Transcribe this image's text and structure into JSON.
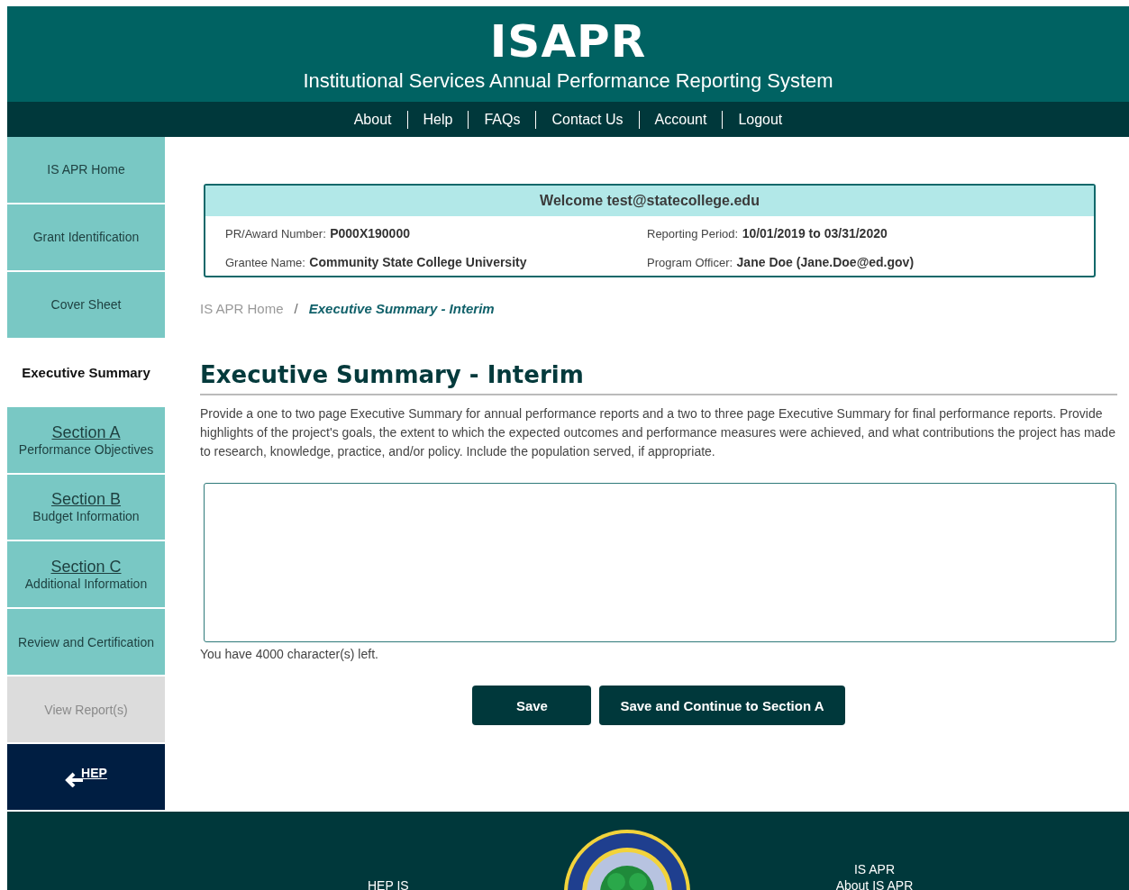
{
  "header": {
    "title": "ISAPR",
    "subtitle": "Institutional Services Annual Performance Reporting System"
  },
  "nav": [
    "About",
    "Help",
    "FAQs",
    "Contact Us",
    "Account",
    "Logout"
  ],
  "sidebar": {
    "items": [
      {
        "kind": "link",
        "label": "IS APR Home",
        "selected": false,
        "disabled": false
      },
      {
        "kind": "link",
        "label": "Grant Identification",
        "selected": false,
        "disabled": false
      },
      {
        "kind": "link",
        "label": "Cover Sheet",
        "selected": false,
        "disabled": false
      },
      {
        "kind": "link",
        "label": "Executive Summary",
        "selected": true,
        "disabled": false
      },
      {
        "kind": "section",
        "label": "Section A",
        "sublabel": "Performance Objectives",
        "selected": false,
        "disabled": false
      },
      {
        "kind": "section",
        "label": "Section B",
        "sublabel": "Budget Information",
        "selected": false,
        "disabled": false
      },
      {
        "kind": "section",
        "label": "Section C",
        "sublabel": "Additional Information",
        "selected": false,
        "disabled": false
      },
      {
        "kind": "link",
        "label": "Review and Certification",
        "selected": false,
        "disabled": false
      },
      {
        "kind": "link",
        "label": "View Report(s)",
        "selected": false,
        "disabled": true
      },
      {
        "kind": "back",
        "label": "HEP",
        "selected": false,
        "disabled": false
      }
    ]
  },
  "info_panel": {
    "welcome": "Welcome test@statecollege.edu",
    "fields": [
      {
        "label": "PR/Award Number:",
        "value": "P000X190000"
      },
      {
        "label": "Reporting Period:",
        "value": "10/01/2019 to 03/31/2020"
      },
      {
        "label": "Grantee Name:",
        "value": "Community State College University"
      },
      {
        "label": "Program Officer:",
        "value": "Jane Doe (Jane.Doe@ed.gov)"
      }
    ]
  },
  "breadcrumb": {
    "items": [
      "IS APR Home",
      "Executive Summary - Interim"
    ],
    "separator": "/"
  },
  "page_title": "Executive Summary - Interim",
  "instructions": "Provide a one to two page Executive Summary for annual performance reports and a two to three page Executive Summary for final performance reports. Provide highlights of the project's goals, the extent to which the expected outcomes and performance measures were achieved, and what contributions the project has made to research, knowledge, practice, and/or policy. Include the population served, if appropriate.",
  "char_count": "You have 4000 character(s) left.",
  "buttons": [
    "Save",
    "Save and Continue to Section A"
  ],
  "footer": {
    "left": "HEP IS",
    "right": [
      "IS APR",
      "About IS APR"
    ]
  }
}
